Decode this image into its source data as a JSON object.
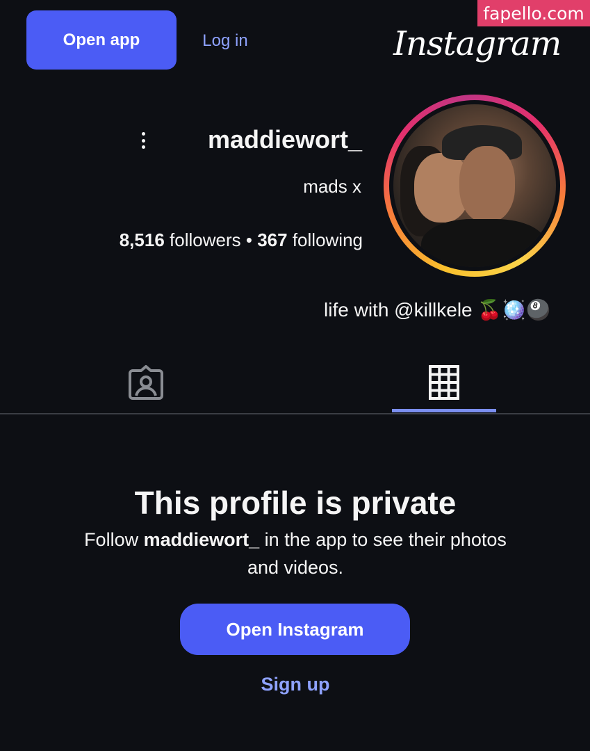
{
  "watermark": "fapello.com",
  "header": {
    "wordmark": "Instagram",
    "login_label": "Log in",
    "open_app_label": "Open app"
  },
  "profile": {
    "username": "maddiewort_",
    "full_name": "mads x",
    "followers_count": "8,516",
    "followers_label": "followers",
    "separator": "•",
    "following_count": "367",
    "following_label": "following",
    "bio": "life with @killkele 🍒🪩🎱"
  },
  "tabs": [
    {
      "name": "posts",
      "icon": "grid-icon",
      "active": true
    },
    {
      "name": "tagged",
      "icon": "tagged-user-icon",
      "active": false
    }
  ],
  "private": {
    "title": "This profile is private",
    "msg_prefix": "Follow",
    "msg_username": "maddiewort_",
    "msg_suffix": "in the app to see their photos and videos.",
    "open_instagram_label": "Open Instagram",
    "signup_label": "Sign up"
  },
  "colors": {
    "background": "#0d0f14",
    "accent": "#4b5cf5",
    "link": "#8ea2ff",
    "watermark": "#e13f6a"
  }
}
